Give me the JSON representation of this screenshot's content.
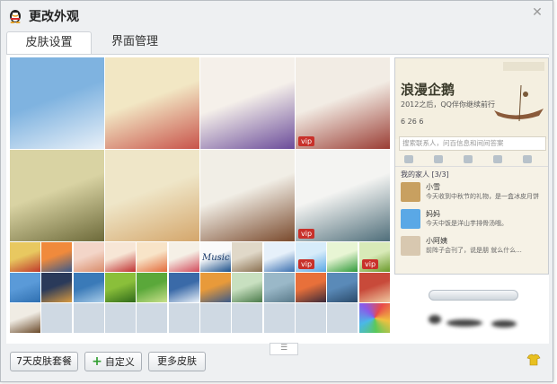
{
  "window": {
    "title": "更改外观",
    "close_label": "✕"
  },
  "tabs": [
    {
      "label": "皮肤设置",
      "active": true
    },
    {
      "label": "界面管理",
      "active": false
    }
  ],
  "skins": {
    "large": [
      {
        "id": "sky-clouds",
        "colors": [
          "#7fb3e0",
          "#e8f0f8"
        ]
      },
      {
        "id": "flower-girl",
        "colors": [
          "#f2e7c4",
          "#c8534a"
        ]
      },
      {
        "id": "purple-girl",
        "colors": [
          "#f5f0ea",
          "#6b4c9a"
        ]
      },
      {
        "id": "pavilion",
        "colors": [
          "#f2ece4",
          "#9a3d34"
        ],
        "badge": "vip"
      },
      {
        "id": "swing-kids",
        "colors": [
          "#d9d3a3",
          "#6d6a3a"
        ]
      },
      {
        "id": "cat-cup",
        "colors": [
          "#efe6c8",
          "#d4a66b"
        ]
      },
      {
        "id": "boat-girl",
        "colors": [
          "#f1eee6",
          "#7a4a2d"
        ]
      },
      {
        "id": "pagoda",
        "colors": [
          "#f4f4f2",
          "#4f6e7a"
        ],
        "badge": "vip"
      }
    ],
    "small_row1": [
      {
        "id": "bird",
        "colors": [
          "#e8c860",
          "#c0392b"
        ]
      },
      {
        "id": "sunset",
        "colors": [
          "#f08a3c",
          "#3b5a8a"
        ]
      },
      {
        "id": "kitty",
        "colors": [
          "#f3d5c8",
          "#d98c6a"
        ]
      },
      {
        "id": "red-toy",
        "colors": [
          "#f7e6d6",
          "#c03030"
        ]
      },
      {
        "id": "flower-pink",
        "colors": [
          "#f8e4c8",
          "#e36a3a"
        ]
      },
      {
        "id": "paper-crane",
        "colors": [
          "#f5f0e6",
          "#d24a5a"
        ]
      },
      {
        "id": "music",
        "colors": [
          "#fafafa",
          "#1a4f8a"
        ],
        "label": "Music"
      },
      {
        "id": "cat-photo",
        "colors": [
          "#e0d8c8",
          "#8a7050"
        ]
      },
      {
        "id": "cute-blue",
        "colors": [
          "#e6f0fa",
          "#3a6fb0"
        ]
      },
      {
        "id": "cloud-vip",
        "colors": [
          "#d7ecfa",
          "#5aa8e6"
        ],
        "badge": "vip"
      },
      {
        "id": "clover",
        "colors": [
          "#e8f5d4",
          "#2f9a3a"
        ]
      },
      {
        "id": "green-vip",
        "colors": [
          "#d8eab8",
          "#6a9a2a"
        ],
        "badge": "vip"
      }
    ],
    "small_row2": [
      {
        "id": "blue-sky",
        "colors": [
          "#5a9ad8",
          "#2f6fb0"
        ]
      },
      {
        "id": "bridge-night",
        "colors": [
          "#2a3a5a",
          "#d89a40"
        ]
      },
      {
        "id": "ocean",
        "colors": [
          "#3a7ab8",
          "#a8cce8"
        ]
      },
      {
        "id": "snail",
        "colors": [
          "#8abf3a",
          "#2f6a1a"
        ]
      },
      {
        "id": "grass",
        "colors": [
          "#5aa83a",
          "#c8e08a"
        ]
      },
      {
        "id": "dandelion",
        "colors": [
          "#3a6aa8",
          "#e8f0f8"
        ]
      },
      {
        "id": "surfer",
        "colors": [
          "#e89a3a",
          "#3a5a8a"
        ]
      },
      {
        "id": "bamboo",
        "colors": [
          "#c8e0c0",
          "#4a7a4a"
        ]
      },
      {
        "id": "forest-mist",
        "colors": [
          "#9ab8c8",
          "#5a7a8a"
        ]
      },
      {
        "id": "dusk",
        "colors": [
          "#e8703a",
          "#3a2a3a"
        ]
      },
      {
        "id": "lake",
        "colors": [
          "#5a8ab8",
          "#2a4a6a"
        ]
      },
      {
        "id": "boat-red",
        "colors": [
          "#c84a3a",
          "#f0c8a0"
        ]
      }
    ],
    "small_row3": [
      {
        "id": "rowboat",
        "colors": [
          "#f0ece4",
          "#6a4a2a"
        ]
      }
    ],
    "custom_color": {
      "id": "rainbow",
      "colors": [
        "#e84a4a",
        "#4ab8e8"
      ]
    }
  },
  "preview": {
    "name": "浪漫企鹅",
    "signature": "2012之后，QQ伴你继续前行",
    "stats": "6  26  6",
    "search_placeholder": "搜索联系人，问百信息和间间答案",
    "group": "我的家人 [3/3]",
    "contacts": [
      {
        "name": "小雪",
        "message": "今天收到中秋节的礼物，是一盒冰皮月饼",
        "color": "#c8a060"
      },
      {
        "name": "妈妈",
        "message": "今天中饭是洋山芋排骨汤哦。",
        "color": "#5aa8e6"
      },
      {
        "name": "小阿姨",
        "message": "前阵子会刊了，说是朋 就么什么...",
        "color": "#d8c8b0"
      }
    ],
    "transparency": 1.0
  },
  "buttons": {
    "package": "7天皮肤套餐",
    "custom": "自定义",
    "more": "更多皮肤"
  },
  "pager_label": "☰"
}
